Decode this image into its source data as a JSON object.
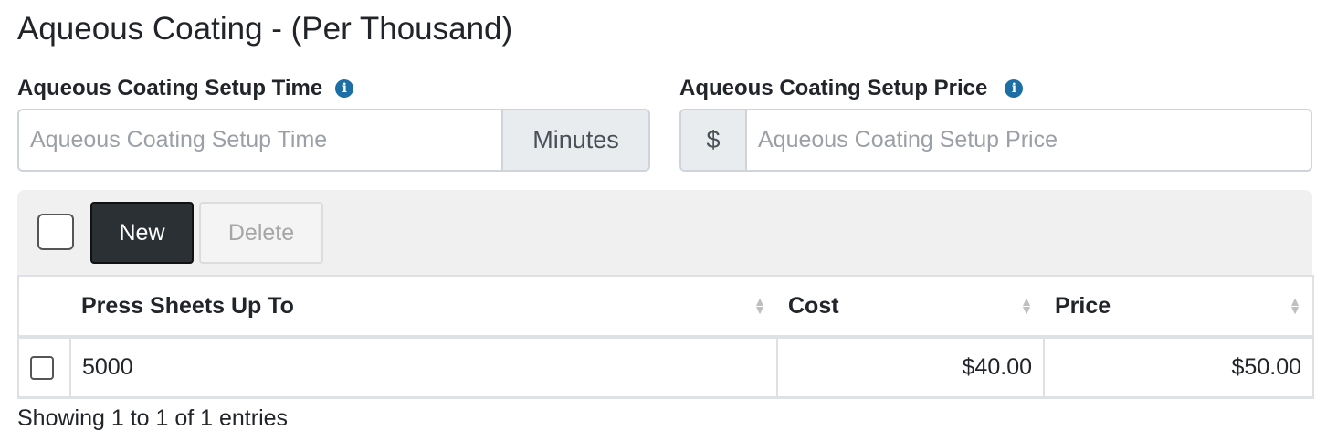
{
  "page": {
    "title": "Aqueous Coating - (Per Thousand)"
  },
  "setup_time": {
    "label": "Aqueous Coating Setup Time",
    "placeholder": "Aqueous Coating Setup Time",
    "value": "",
    "unit": "Minutes",
    "info_icon": "info-icon"
  },
  "setup_price": {
    "label": "Aqueous Coating Setup Price",
    "placeholder": "Aqueous Coating Setup Price",
    "value": "",
    "currency": "$",
    "info_icon": "info-icon"
  },
  "toolbar": {
    "new_label": "New",
    "delete_label": "Delete"
  },
  "table": {
    "columns": [
      "Press Sheets Up To",
      "Cost",
      "Price"
    ],
    "rows": [
      {
        "sheets": "5000",
        "cost": "$40.00",
        "price": "$50.00"
      }
    ],
    "info": "Showing 1 to 1 of 1 entries"
  },
  "colors": {
    "accent_info": "#1c6ea4",
    "primary_button": "#2b3035"
  }
}
